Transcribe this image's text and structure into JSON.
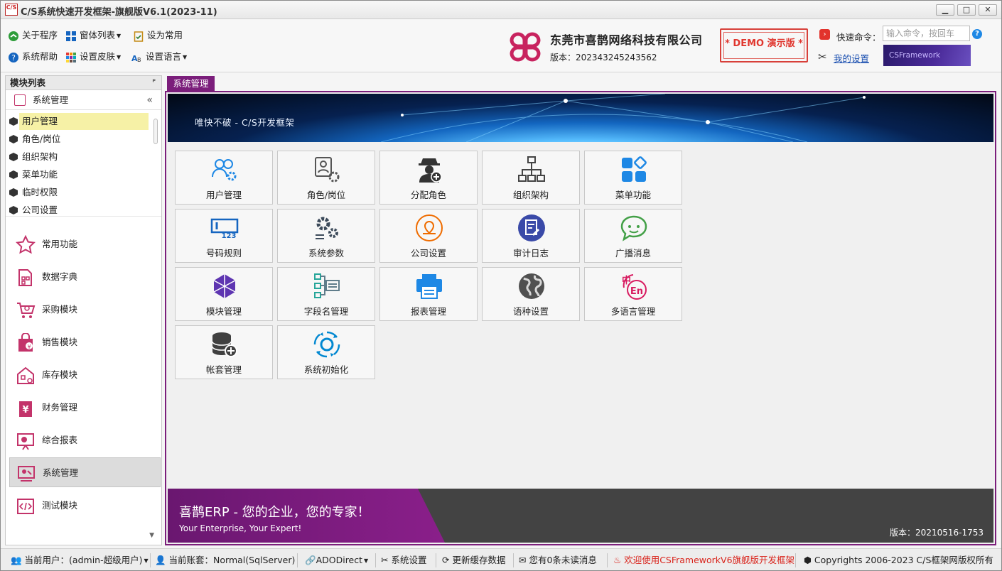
{
  "window": {
    "title": "C/S系统快速开发框架-旗舰版V6.1(2023-11)",
    "app_icon_text": "C/S",
    "min": "▁",
    "max": "□",
    "close": "✕"
  },
  "toolbar": {
    "about": "关于程序",
    "windows_list": "窗体列表",
    "set_common": "设为常用",
    "help": "系统帮助",
    "set_skin": "设置皮肤",
    "set_language": "设置语言",
    "company": "东莞市喜鹊网络科技有限公司",
    "version": "版本：202343245243562",
    "demo": "* DEMO 演示版 *",
    "quick_cmd_label": "快速命令：",
    "quick_cmd_placeholder": "输入命令，按回车",
    "my_settings": "我的设置",
    "banner": "CSFramework",
    "help_glyph": "?",
    "cmd_glyph": "›",
    "tools_glyph": "✂"
  },
  "left": {
    "header": "模块列表",
    "pin": "ᴾ",
    "group": "系统管理",
    "collapse": "«",
    "scroll_down": "▼",
    "tree": [
      "用户管理",
      "角色/岗位",
      "组织架构",
      "菜单功能",
      "临时权限",
      "公司设置"
    ],
    "nav": [
      "常用功能",
      "数据字典",
      "采购模块",
      "销售模块",
      "库存模块",
      "财务管理",
      "综合报表",
      "系统管理",
      "测试模块"
    ],
    "nav_active": "系统管理",
    "tree_active": "用户管理"
  },
  "main": {
    "tab": "系统管理",
    "banner_title": "唯快不破 - C/S开发框架",
    "tiles": [
      "用户管理",
      "角色/岗位",
      "分配角色",
      "组织架构",
      "菜单功能",
      "号码规则",
      "系统参数",
      "公司设置",
      "审计日志",
      "广播消息",
      "模块管理",
      "字段名管理",
      "报表管理",
      "语种设置",
      "多语言管理",
      "帐套管理",
      "系统初始化"
    ],
    "footer_slogan": "喜鹊ERP - 您的企业，您的专家！",
    "footer_sub": "Your Enterprise, Your Expert!",
    "footer_version": "版本：20210516-1753"
  },
  "status": {
    "user": "当前用户：(admin-超级用户)",
    "account": "当前账套：Normal(SqlServer)",
    "ado": "ADODirect",
    "settings": "系统设置",
    "refresh": "更新缓存数据",
    "messages": "您有0条未读消息",
    "welcome": "欢迎使用CSFrameworkV6旗舰版开发框架",
    "copyright": "Copyrights 2006-2023 C/S框架网版权所有"
  },
  "colors": {
    "accent": "#7b1e7b",
    "highlight": "#f6f1a6",
    "link": "#1a4fb0",
    "demo": "#e0362e"
  }
}
